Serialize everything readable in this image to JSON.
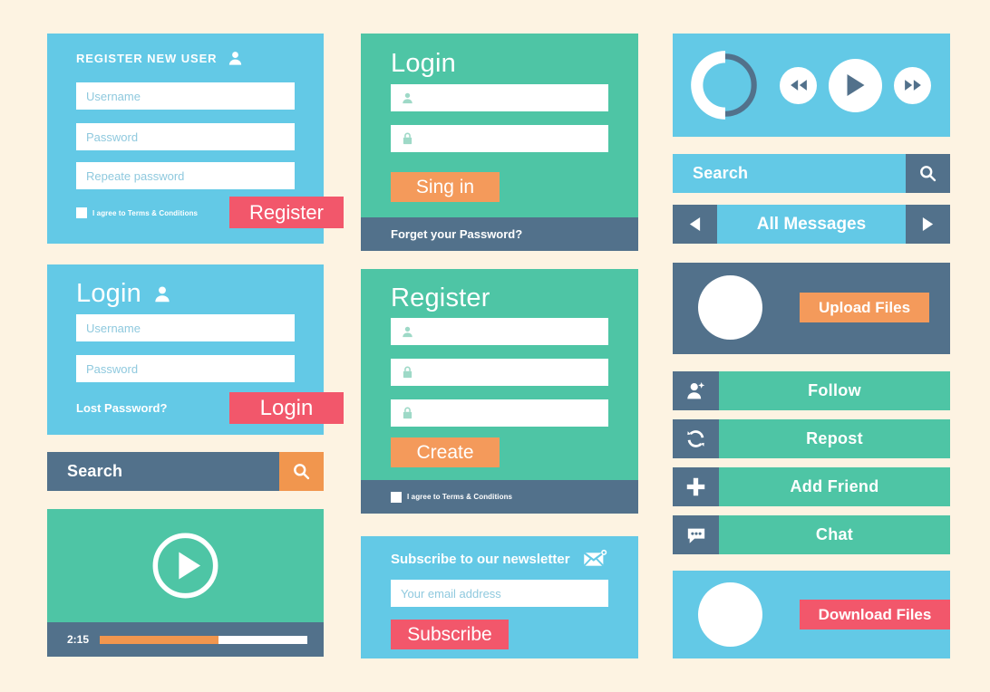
{
  "palette": {
    "background": "#fdf3e2",
    "blue": "#63c9e6",
    "teal": "#4ec5a5",
    "slate": "#52718b",
    "orange": "#f1964e",
    "red": "#f2576b",
    "white": "#ffffff"
  },
  "register_new_user": {
    "title": "REGISTER NEW USER",
    "username_placeholder": "Username",
    "password_placeholder": "Password",
    "repeat_placeholder": "Repeate password",
    "terms_label": "I agree to Terms & Conditions",
    "submit_label": "Register"
  },
  "login_left": {
    "title": "Login",
    "username_placeholder": "Username",
    "password_placeholder": "Password",
    "lost_password_label": "Lost Password?",
    "submit_label": "Login"
  },
  "search_left": {
    "placeholder": "Search",
    "icon": "search-icon"
  },
  "video_player": {
    "play_icon": "play-icon",
    "time_label": "2:15",
    "progress_percent": 57
  },
  "login_mid": {
    "title": "Login",
    "user_field_icon": "user-icon",
    "password_field_icon": "lock-icon",
    "submit_label": "Sing in",
    "footer_label": "Forget your Password?"
  },
  "register_mid": {
    "title": "Register",
    "user_field_icon": "user-icon",
    "password_field_icon": "lock-icon",
    "repeat_field_icon": "lock-icon",
    "submit_label": "Create",
    "terms_label": "I agree to Terms & Conditions"
  },
  "newsletter": {
    "title": "Subscribe to our newsletter",
    "envelope_icon": "envelope-icon",
    "email_placeholder": "Your email address",
    "submit_label": "Subscribe"
  },
  "media_controls": {
    "loader_icon": "circular-progress-icon",
    "loader_percent": 50,
    "rewind_icon": "rewind-icon",
    "play_icon": "play-icon",
    "forward_icon": "fast-forward-icon"
  },
  "search_right": {
    "placeholder": "Search",
    "icon": "search-icon"
  },
  "nav_messages": {
    "prev_icon": "chevron-left-icon",
    "label": "All Messages",
    "next_icon": "chevron-right-icon"
  },
  "upload_panel": {
    "icon": "upload-icon",
    "button_label": "Upload Files"
  },
  "social_actions": [
    {
      "icon": "add-user-icon",
      "label": "Follow"
    },
    {
      "icon": "repost-icon",
      "label": "Repost"
    },
    {
      "icon": "plus-icon",
      "label": "Add Friend"
    },
    {
      "icon": "chat-bubble-icon",
      "label": "Chat"
    }
  ],
  "download_panel": {
    "icon": "download-icon",
    "button_label": "Download Files"
  }
}
